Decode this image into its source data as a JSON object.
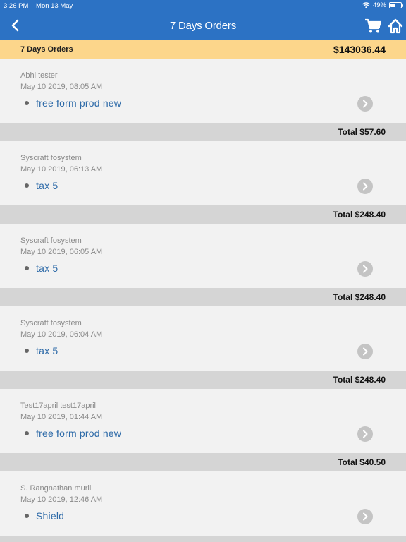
{
  "status_bar": {
    "time": "3:26 PM",
    "date": "Mon 13 May",
    "battery": "49%",
    "battery_level": 0.49
  },
  "nav": {
    "back_icon": "chevron-left-icon",
    "title": "7 Days Orders",
    "cart_icon": "cart-icon",
    "home_icon": "home-icon"
  },
  "summary": {
    "label": "7 Days Orders",
    "amount": "$143036.44"
  },
  "orders": [
    {
      "customer": "Abhi tester",
      "datetime": "May 10 2019, 08:05 AM",
      "product": "free form prod new",
      "total": "Total $57.60"
    },
    {
      "customer": "Syscraft fosystem",
      "datetime": "May 10 2019, 06:13 AM",
      "product": "tax 5",
      "total": "Total $248.40"
    },
    {
      "customer": "Syscraft fosystem",
      "datetime": "May 10 2019, 06:05 AM",
      "product": "tax 5",
      "total": "Total $248.40"
    },
    {
      "customer": "Syscraft fosystem",
      "datetime": "May 10 2019, 06:04 AM",
      "product": "tax 5",
      "total": "Total $248.40"
    },
    {
      "customer": "Test17april test17april",
      "datetime": "May 10 2019, 01:44 AM",
      "product": "free form prod new",
      "total": "Total $40.50"
    },
    {
      "customer": "S. Rangnathan murli",
      "datetime": "May 10 2019, 12:46 AM",
      "product": "Shield",
      "total": ""
    }
  ]
}
